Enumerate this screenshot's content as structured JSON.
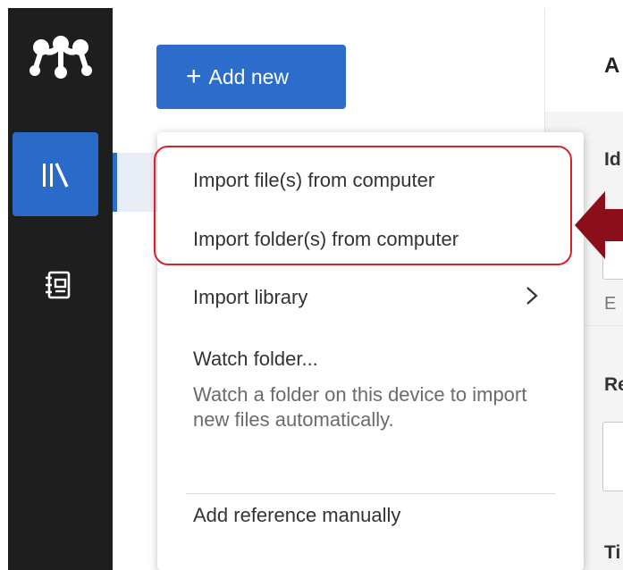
{
  "sidebar": {
    "logo": "mendeley-logo-icon",
    "items": [
      {
        "icon": "library-icon",
        "active": true
      },
      {
        "icon": "notebook-icon",
        "active": false
      }
    ]
  },
  "panel": {
    "add_button_label": "Add new",
    "add_button_icon": "plus-icon"
  },
  "menu": {
    "import_files": "Import file(s) from computer",
    "import_folders": "Import folder(s) from computer",
    "import_library": "Import library",
    "import_library_icon": "chevron-right-icon",
    "watch_folder": "Watch folder...",
    "watch_folder_desc": "Watch a folder on this device to import new files automatically.",
    "add_manual": "Add reference manually"
  },
  "right_pane": {
    "heading": "A",
    "id_label": "Id",
    "helper": "E",
    "re_label": "Re",
    "ti_label": "Ti"
  },
  "annotation": {
    "highlight_color": "#d6232a",
    "arrow_color": "#8b0e1a"
  },
  "colors": {
    "accent": "#2c6ccb",
    "sidebar_bg": "#1e1e1e"
  }
}
